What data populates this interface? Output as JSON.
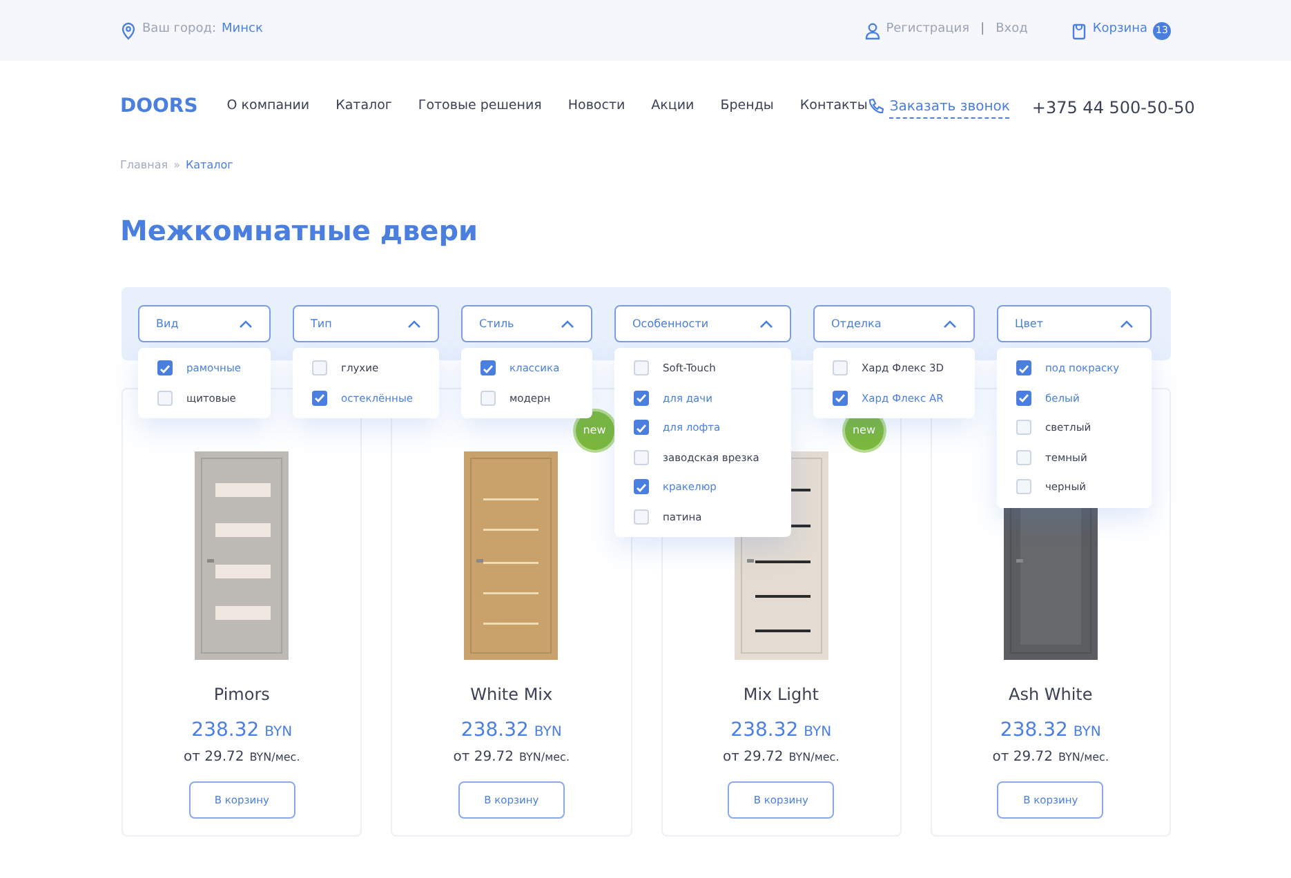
{
  "top_bar": {
    "city_label": "Ваш город:",
    "city": "Минск",
    "register": "Регистрация",
    "separator": "|",
    "login": "Вход",
    "cart": "Корзина",
    "cart_count": "13"
  },
  "nav": {
    "logo": "DOORS",
    "items": [
      "О компании",
      "Каталог",
      "Готовые решения",
      "Новости",
      "Акции",
      "Бренды",
      "Контакты"
    ],
    "callback": "Заказать звонок",
    "phone": "+375 44 500-50-50"
  },
  "breadcrumbs": [
    {
      "label": "Главная",
      "current": false
    },
    {
      "label": "Каталог",
      "current": true
    }
  ],
  "breadcrumb_separator": "»",
  "title": "Межкомнатные двери",
  "filters": [
    {
      "label": "Вид",
      "expanded": true,
      "options": [
        {
          "label": "рамочные",
          "checked": true
        },
        {
          "label": "щитовые",
          "checked": false
        }
      ]
    },
    {
      "label": "Тип",
      "expanded": true,
      "options": [
        {
          "label": "глухие",
          "checked": false
        },
        {
          "label": "остеклённые",
          "checked": true
        }
      ]
    },
    {
      "label": "Стиль",
      "expanded": true,
      "options": [
        {
          "label": "классика",
          "checked": true
        },
        {
          "label": "модерн",
          "checked": false
        }
      ]
    },
    {
      "label": "Особенности",
      "expanded": true,
      "options": [
        {
          "label": "Soft-Touch",
          "checked": false
        },
        {
          "label": "для дачи",
          "checked": true
        },
        {
          "label": "для лофта",
          "checked": true
        },
        {
          "label": "заводская врезка",
          "checked": false
        },
        {
          "label": "кракелюр",
          "checked": true
        },
        {
          "label": "патина",
          "checked": false
        }
      ]
    },
    {
      "label": "Отделка",
      "expanded": true,
      "options": [
        {
          "label": "Хард Флекс 3D",
          "checked": false
        },
        {
          "label": "Хард Флекс AR",
          "checked": true
        }
      ]
    },
    {
      "label": "Цвет",
      "expanded": true,
      "options": [
        {
          "label": "под покраску",
          "checked": true
        },
        {
          "label": "белый",
          "checked": true
        },
        {
          "label": "светлый",
          "checked": false
        },
        {
          "label": "темный",
          "checked": false
        },
        {
          "label": "черный",
          "checked": false
        }
      ]
    }
  ],
  "products": [
    {
      "name": "Pimors",
      "is_new": false,
      "price": "238.32",
      "currency": "BYN",
      "monthly": "от 29.72",
      "monthly_unit": "BYN/мес.",
      "button": "В корзину"
    },
    {
      "name": "White Mix",
      "is_new": true,
      "badge": "new",
      "price": "238.32",
      "currency": "BYN",
      "monthly": "от 29.72",
      "monthly_unit": "BYN/мес.",
      "button": "В корзину"
    },
    {
      "name": "Mix Light",
      "is_new": true,
      "badge": "new",
      "price": "238.32",
      "currency": "BYN",
      "monthly": "от 29.72",
      "monthly_unit": "BYN/мес.",
      "button": "В корзину"
    },
    {
      "name": "Ash White",
      "is_new": false,
      "price": "238.32",
      "currency": "BYN",
      "monthly": "от 29.72",
      "monthly_unit": "BYN/мес.",
      "button": "В корзину"
    }
  ]
}
